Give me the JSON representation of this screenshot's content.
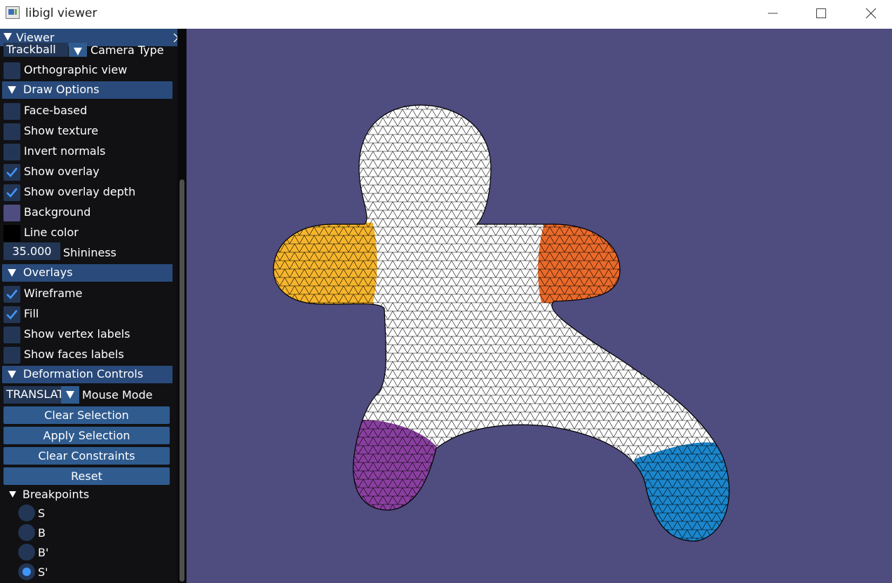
{
  "window": {
    "title": "libigl viewer"
  },
  "viewer_panel": {
    "title": "Viewer",
    "camera": {
      "value": "Trackball",
      "label": "Camera Type"
    },
    "orthographic": {
      "label": "Orthographic view",
      "checked": false
    },
    "draw_options": {
      "title": "Draw Options",
      "face_based": {
        "label": "Face-based",
        "checked": false
      },
      "show_texture": {
        "label": "Show texture",
        "checked": false
      },
      "invert_normals": {
        "label": "Invert normals",
        "checked": false
      },
      "show_overlay": {
        "label": "Show overlay",
        "checked": true
      },
      "show_overlay_depth": {
        "label": "Show overlay depth",
        "checked": true
      },
      "background": {
        "label": "Background",
        "color": "#4f4c7f"
      },
      "line_color": {
        "label": "Line color",
        "color": "#000000"
      },
      "shininess": {
        "value": "35.000",
        "label": "Shininess"
      }
    },
    "overlays": {
      "title": "Overlays",
      "wireframe": {
        "label": "Wireframe",
        "checked": true
      },
      "fill": {
        "label": "Fill",
        "checked": true
      },
      "vertex_labels": {
        "label": "Show vertex labels",
        "checked": false
      },
      "faces_labels": {
        "label": "Show faces labels",
        "checked": false
      }
    },
    "deformation": {
      "title": "Deformation Controls",
      "mouse_mode": {
        "value": "TRANSLATE",
        "label": "Mouse Mode"
      },
      "buttons": {
        "clear_selection": "Clear Selection",
        "apply_selection": "Apply Selection",
        "clear_constraints": "Clear Constraints",
        "reset": "Reset"
      },
      "breakpoints": {
        "title": "Breakpoints",
        "options": [
          "S",
          "B",
          "B'",
          "S'"
        ],
        "selected": "S'"
      }
    }
  },
  "colors": {
    "viewport_background": "#4f4c7f",
    "panel_background": "#111114",
    "header": "#294a7a",
    "button": "#2f5b8f",
    "frame": "#233655",
    "check": "#4296fa",
    "handle_yellow": "#f6b52c",
    "handle_orange": "#ea6a2a",
    "handle_purple": "#8a3fa0",
    "handle_blue": "#1b86cc"
  }
}
